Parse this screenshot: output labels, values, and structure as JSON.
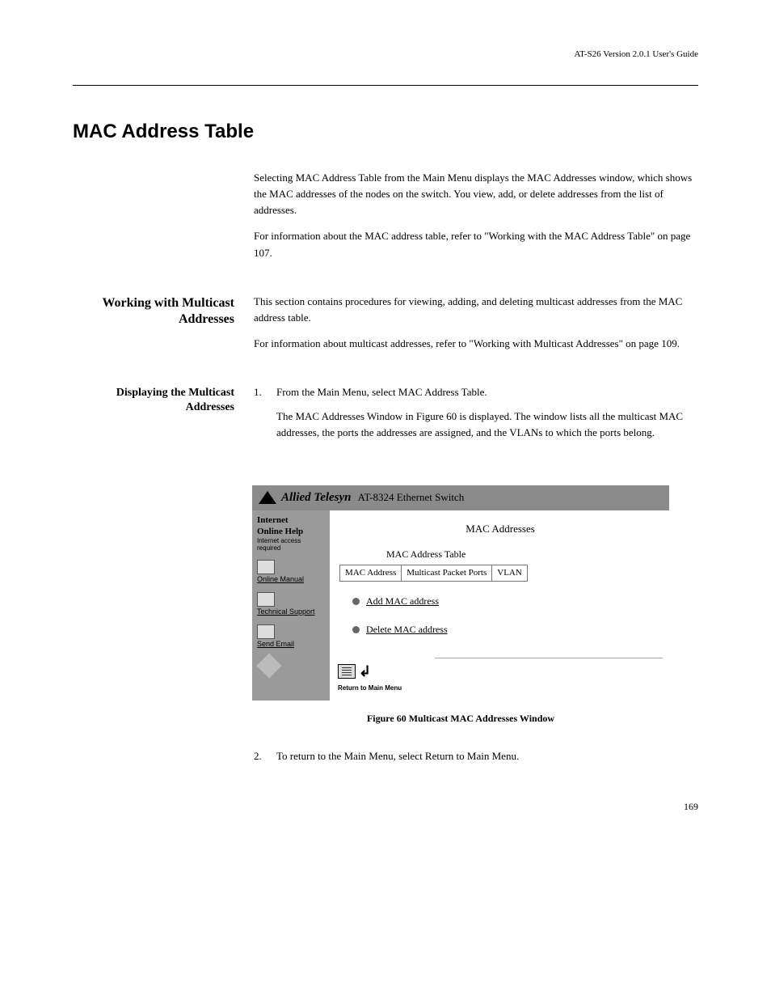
{
  "page": {
    "top_header": "AT-S26 Version 2.0.1 User's Guide",
    "number": "169"
  },
  "section": {
    "title": "MAC Address Table",
    "subtitle": "Working with Multicast Addresses",
    "intro_1": "Selecting MAC Address Table from the Main Menu displays the MAC Addresses window, which shows the MAC addresses of the nodes on the switch. You view, add, or delete addresses from the list of addresses.",
    "intro_2": "For information about the MAC address table, refer to \"Working with the MAC Address Table\" on page 107.",
    "multi_intro": "This section contains procedures for viewing, adding, and deleting multicast addresses from the MAC address table.",
    "multi_intro_2": "For information about multicast addresses, refer to \"Working with Multicast Addresses\" on page 109."
  },
  "subsection": {
    "title": "Displaying the Multicast Addresses",
    "step_1_num": "1.",
    "step_1": "From the Main Menu, select MAC Address Table.",
    "step_1b": "The MAC Addresses Window in Figure 60 is displayed. The window lists all the multicast MAC addresses, the ports the addresses are assigned, and the VLANs to which the ports belong."
  },
  "screenshot": {
    "brand": "Allied Telesyn",
    "model": "AT-8324 Ethernet Switch",
    "sidebar": {
      "title1": "Internet",
      "title2": "Online Help",
      "note": "Internet access required",
      "online_manual": "Online Manual",
      "tech_support": "Technical Support",
      "send_email": "Send Email"
    },
    "main": {
      "page_title": "MAC Addresses",
      "table_title": "MAC Address Table",
      "col1": "MAC Address",
      "col2": "Multicast Packet Ports",
      "col3": "VLAN",
      "action_add": "Add MAC address",
      "action_delete": "Delete MAC address",
      "return_label": "Return to Main Menu"
    }
  },
  "figure_caption": "Figure 60   Multicast MAC Addresses Window",
  "step_2": {
    "num": "2.",
    "body": "To return to the Main Menu, select Return to Main Menu."
  }
}
